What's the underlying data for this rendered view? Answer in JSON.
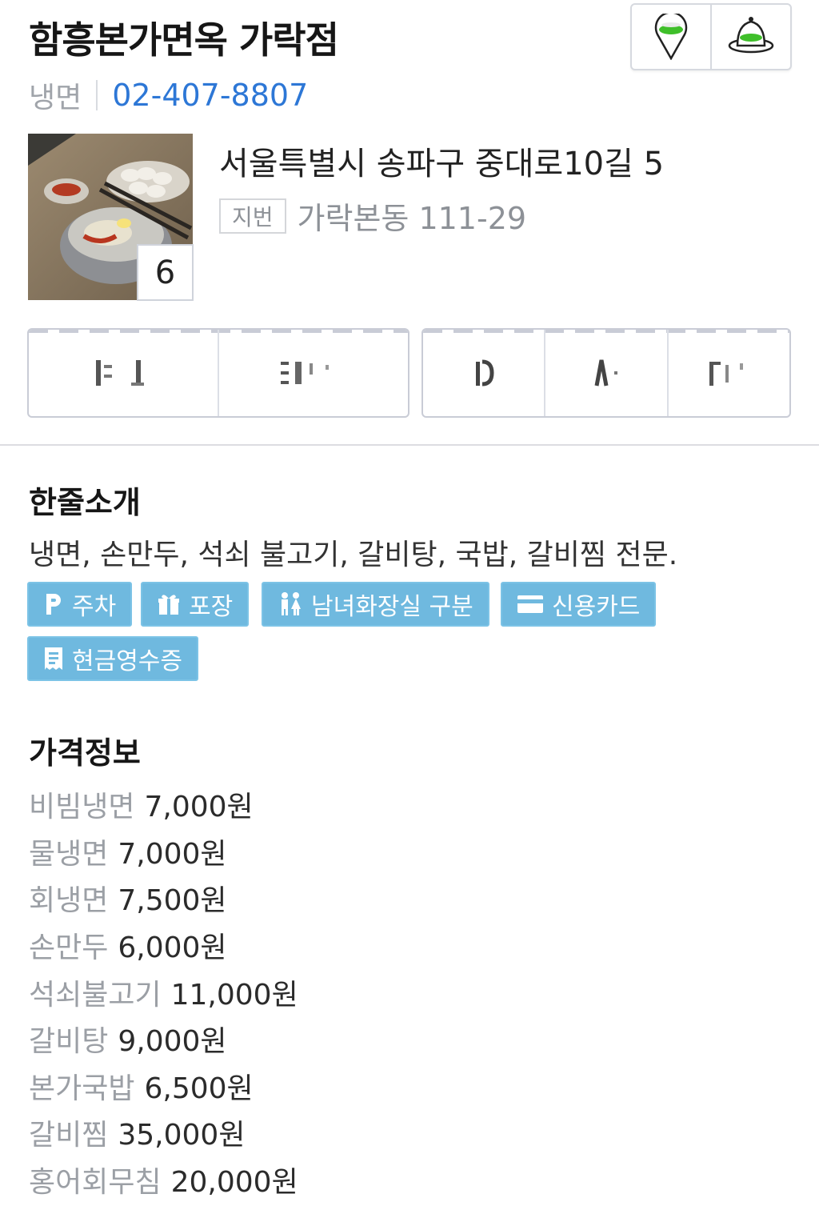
{
  "header": {
    "title": "함흥본가면옥 가락점",
    "category": "냉면",
    "phone": "02-407-8807",
    "map_buttons": [
      {
        "icon": "map-pin-icon"
      },
      {
        "icon": "street-view-icon"
      }
    ]
  },
  "photo": {
    "count": "6"
  },
  "address": {
    "road": "서울특별시 송파구 중대로10길 5",
    "lot_label": "지번",
    "lot": "가락본동 111-29"
  },
  "intro": {
    "title": "한줄소개",
    "text": "냉면, 손만두, 석쇠 불고기, 갈비탕, 국밥, 갈비찜 전문."
  },
  "amenities": [
    {
      "label": "주차",
      "icon": "parking-icon"
    },
    {
      "label": "포장",
      "icon": "gift-icon"
    },
    {
      "label": "남녀화장실 구분",
      "icon": "restroom-icon"
    },
    {
      "label": "신용카드",
      "icon": "credit-card-icon"
    },
    {
      "label": "현금영수증",
      "icon": "receipt-icon"
    }
  ],
  "prices": {
    "title": "가격정보",
    "items": [
      {
        "name": "비빔냉면",
        "price": "7,000원"
      },
      {
        "name": "물냉면",
        "price": "7,000원"
      },
      {
        "name": "회냉면",
        "price": "7,500원"
      },
      {
        "name": "손만두",
        "price": "6,000원"
      },
      {
        "name": "석쇠불고기",
        "price": "11,000원"
      },
      {
        "name": "갈비탕",
        "price": "9,000원"
      },
      {
        "name": "본가국밥",
        "price": "6,500원"
      },
      {
        "name": "갈비찜",
        "price": "35,000원"
      },
      {
        "name": "홍어회무침",
        "price": "20,000원"
      }
    ]
  },
  "colors": {
    "phone": "#2d77d6",
    "tag_bg": "#6fb9df",
    "map_icon_green": "#3fbf2a"
  }
}
